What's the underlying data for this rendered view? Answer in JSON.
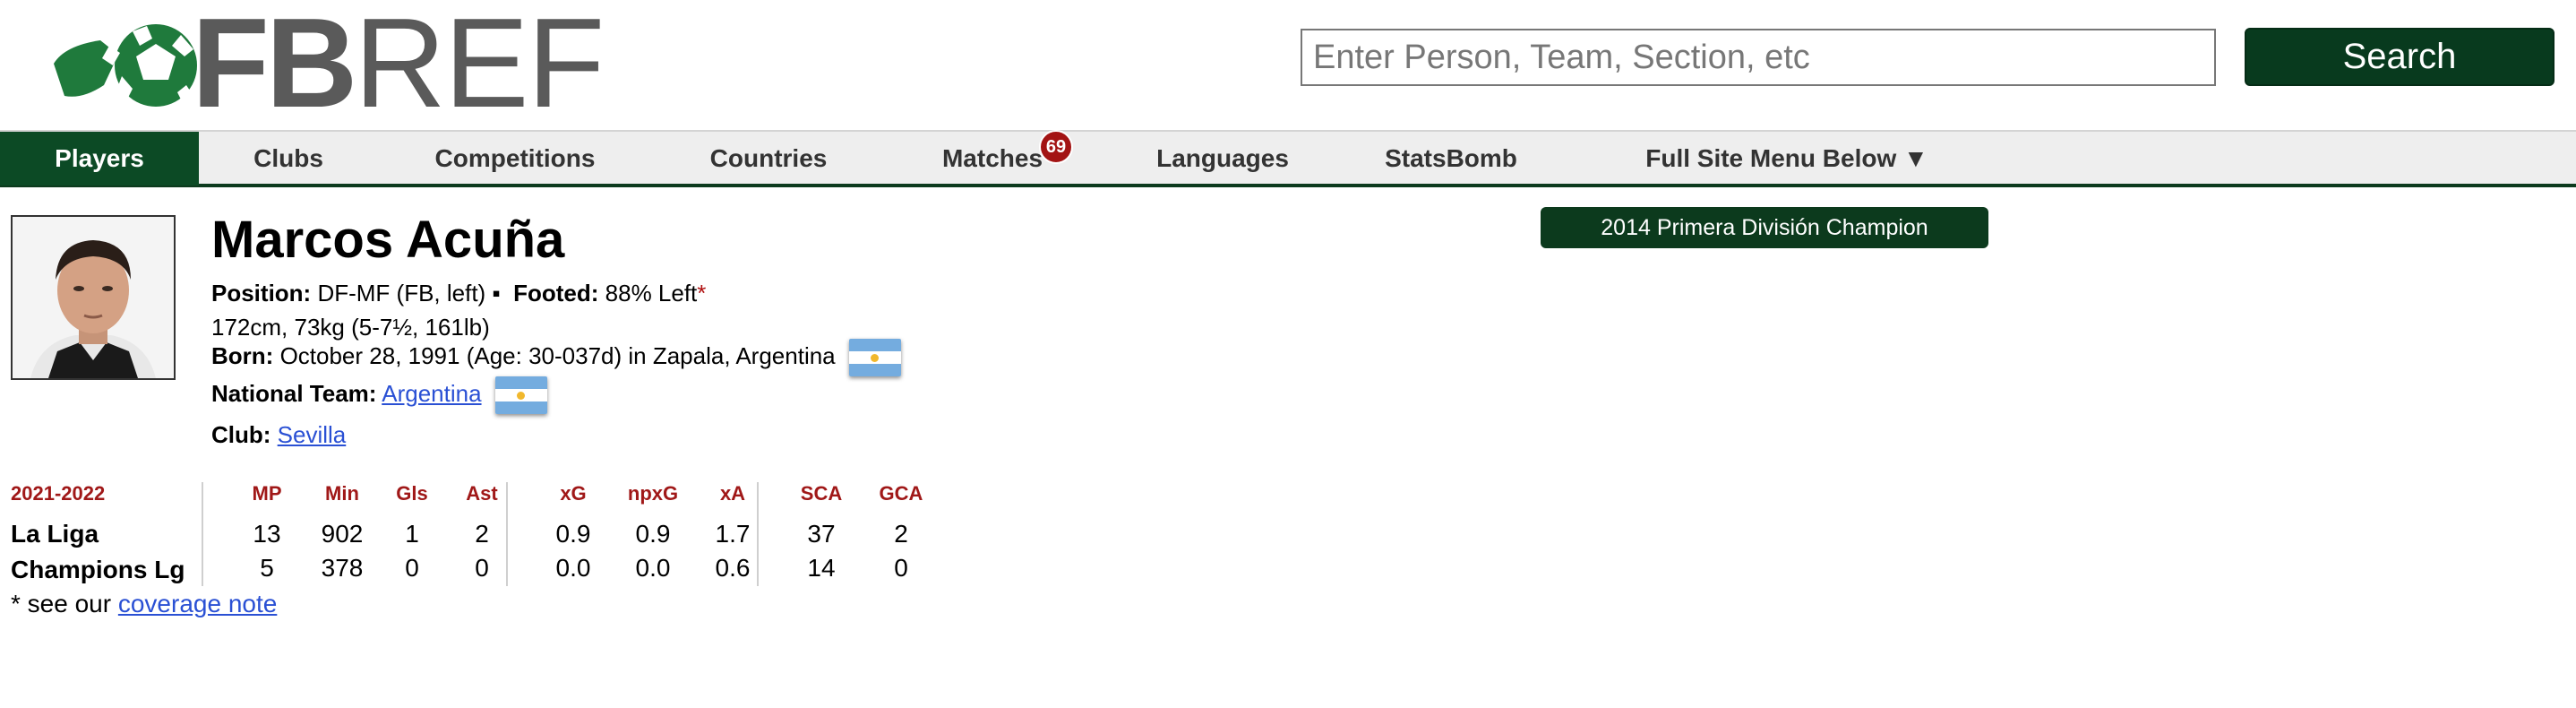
{
  "logo": {
    "text_bold": "FB",
    "text_light": "REF"
  },
  "search": {
    "placeholder": "Enter Person, Team, Section, etc",
    "button_label": "Search"
  },
  "nav": {
    "items": [
      {
        "label": "Players"
      },
      {
        "label": "Clubs"
      },
      {
        "label": "Competitions"
      },
      {
        "label": "Countries"
      },
      {
        "label": "Matches",
        "badge": "69"
      },
      {
        "label": "Languages"
      },
      {
        "label": "StatsBomb"
      },
      {
        "label": "Full Site Menu Below ▼"
      }
    ]
  },
  "player": {
    "name": "Marcos Acuña",
    "position_label": "Position:",
    "position_value": "DF-MF (FB, left) ▪",
    "footed_label": "Footed:",
    "footed_value": "88% Left",
    "footed_mark": "*",
    "physical": "172cm, 73kg (5-7½, 161lb)",
    "born_label": "Born:",
    "born_value": "October 28, 1991 (Age: 30-037d) in Zapala, Argentina",
    "national_team_label": "National Team:",
    "national_team_value": "Argentina",
    "club_label": "Club:",
    "club_value": "Sevilla",
    "award": "2014 Primera División Champion"
  },
  "stats": {
    "season": "2021-2022",
    "columns": [
      "MP",
      "Min",
      "Gls",
      "Ast",
      "xG",
      "npxG",
      "xA",
      "SCA",
      "GCA"
    ],
    "rows": [
      {
        "competition": "La Liga",
        "values": [
          "13",
          "902",
          "1",
          "2",
          "0.9",
          "0.9",
          "1.7",
          "37",
          "2"
        ]
      },
      {
        "competition": "Champions Lg",
        "values": [
          "5",
          "378",
          "0",
          "0",
          "0.0",
          "0.0",
          "0.6",
          "14",
          "0"
        ]
      }
    ]
  },
  "note": {
    "prefix": "* see our",
    "link": "coverage note"
  },
  "colors": {
    "brand_green": "#0c3a1d",
    "header_red": "#a01818",
    "link_blue": "#2a50d4",
    "badge_red": "#a31414"
  }
}
